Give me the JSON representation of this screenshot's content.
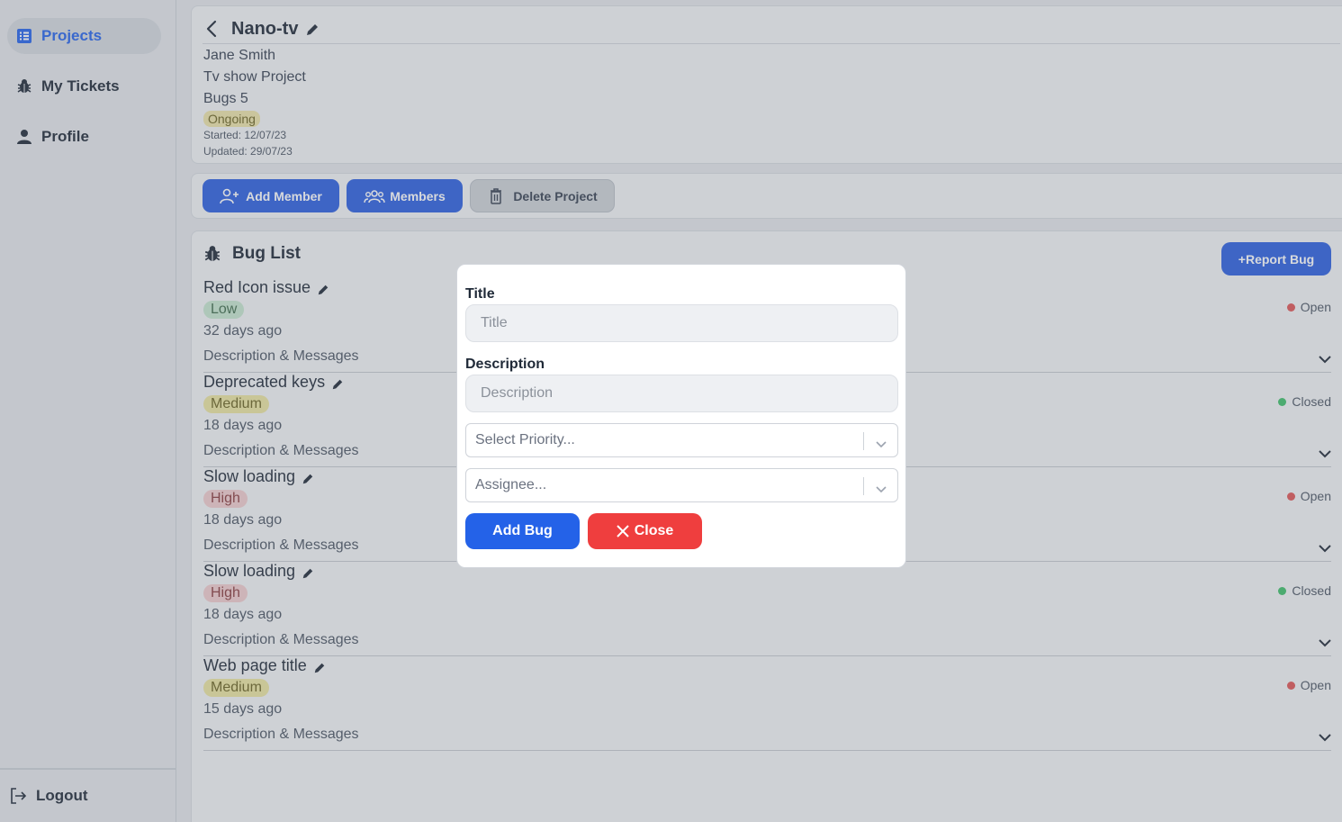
{
  "sidebar": {
    "items": [
      {
        "label": "Projects",
        "icon": "list-icon",
        "active": true
      },
      {
        "label": "My Tickets",
        "icon": "bug-icon"
      },
      {
        "label": "Profile",
        "icon": "user-icon"
      }
    ],
    "logout_label": "Logout"
  },
  "project": {
    "title": "Nano-tv",
    "owner": "Jane Smith",
    "description": "Tv show Project",
    "bugs": "Bugs 5",
    "status": "Ongoing",
    "started": "Started: 12/07/23",
    "updated": "Updated: 29/07/23"
  },
  "actions": {
    "add_member": "Add Member",
    "members": "Members",
    "delete_project": "Delete Project"
  },
  "bug_list": {
    "title": "Bug List",
    "report_label": "+Report Bug",
    "bugs": [
      {
        "name": "Red Icon issue",
        "priority": "Low",
        "age": "32 days ago",
        "desc": "Description & Messages",
        "status": "Open"
      },
      {
        "name": "Deprecated keys",
        "priority": "Medium",
        "age": "18 days ago",
        "desc": "Description & Messages",
        "status": "Closed"
      },
      {
        "name": "Slow loading",
        "priority": "High",
        "age": "18 days ago",
        "desc": "Description & Messages",
        "status": "Open"
      },
      {
        "name": "Slow loading",
        "priority": "High",
        "age": "18 days ago",
        "desc": "Description & Messages",
        "status": "Closed"
      },
      {
        "name": "Web page title",
        "priority": "Medium",
        "age": "15 days ago",
        "desc": "Description & Messages",
        "status": "Open"
      }
    ]
  },
  "modal": {
    "title_label": "Title",
    "title_placeholder": "Title",
    "description_label": "Description",
    "description_placeholder": "Description",
    "priority_placeholder": "Select Priority...",
    "assignee_placeholder": "Assignee...",
    "add_label": "Add Bug",
    "close_label": "Close"
  },
  "colors": {
    "accent": "#2c5fe0",
    "danger": "#ef3e3e",
    "open": "#e05555",
    "closed": "#3fbf6a"
  }
}
